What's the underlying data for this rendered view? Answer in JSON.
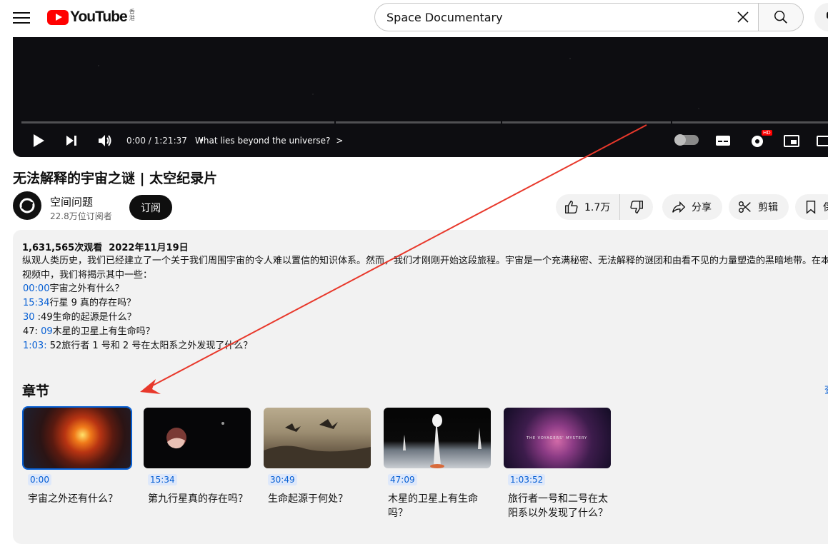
{
  "topbar": {
    "logo_text": "YouTube",
    "logo_region": "香港",
    "search_value": "Space Documentary"
  },
  "player": {
    "time": "0:00 / 1:21:37",
    "separator": "•",
    "chapter_label": "What lies beyond the universe?",
    "chapter_chevron": ">",
    "settings_badge": "HD",
    "progress_played": 0
  },
  "video": {
    "title": "无法解释的宇宙之谜 | 太空纪录片",
    "channel_name": "空间问题",
    "subscribers": "22.8万位订阅者",
    "subscribe_label": "订阅",
    "likes": "1.7万",
    "share_label": "分享",
    "clip_label": "剪辑",
    "save_label": "保"
  },
  "description": {
    "views": "1,631,565次观看",
    "date": "2022年11月19日",
    "text": "纵观人类历史，我们已经建立了一个关于我们周围宇宙的令人难以置信的知识体系。然而，我们才刚刚开始这段旅程。宇宙是一个充满秘密、无法解释的谜团和由看不见的力量塑造的黑暗地带。在本视频中，我们将揭示其中一些：",
    "timestamps": [
      {
        "link": "00:00",
        "text": "宇宙之外有什么？"
      },
      {
        "link": "15:34",
        "text": "行星 9 真的存在吗？"
      },
      {
        "link": "30",
        "text": " :49生命的起源是什么？"
      },
      {
        "prefix": "47: ",
        "link": "09",
        "text": "木星的卫星上有生命吗？"
      },
      {
        "link": "1:03:",
        "text": " 52旅行者 1 号和 2 号在太阳系之外发现了什么？"
      }
    ]
  },
  "chapters": {
    "heading": "章节",
    "more": "查",
    "items": [
      {
        "time": "0:00",
        "label": "宇宙之外还有什么？"
      },
      {
        "time": "15:34",
        "label": "第九行星真的存在吗？"
      },
      {
        "time": "30:49",
        "label": "生命起源于何处？"
      },
      {
        "time": "47:09",
        "label": "木星的卫星上有生命吗？"
      },
      {
        "time": "1:03:52",
        "label": "旅行者一号和二号在太阳系以外发现了什么？",
        "thumb_caption": "THE VOYAGERS' MYSTERY"
      }
    ]
  },
  "colors": {
    "accent_link": "#065fd4",
    "annotation_arrow": "#e8382b",
    "brand_red": "#ff0000"
  }
}
